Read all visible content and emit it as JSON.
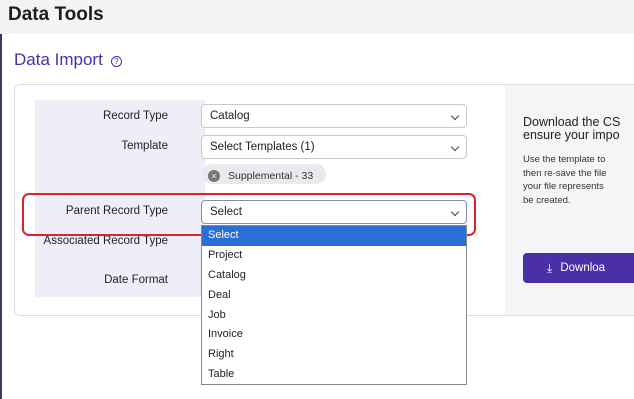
{
  "page": {
    "title": "Data Tools"
  },
  "section": {
    "title": "Data Import",
    "help_icon": "help-circle-icon"
  },
  "form": {
    "record_type": {
      "label": "Record Type",
      "value": "Catalog"
    },
    "template": {
      "label": "Template",
      "value": "Select Templates (1)",
      "chip": "Supplemental - 33"
    },
    "parent_record_type": {
      "label": "Parent Record Type",
      "value": "Select"
    },
    "associated_record_type": {
      "label": "Associated Record Type"
    },
    "date_format": {
      "label": "Date Format"
    }
  },
  "dropdown": {
    "options": [
      "Select",
      "Project",
      "Catalog",
      "Deal",
      "Job",
      "Invoice",
      "Right",
      "Table"
    ],
    "selected_index": 0
  },
  "download_panel": {
    "title_line1": "Download the CS",
    "title_line2": "ensure your impo",
    "desc_line1": "Use the template to",
    "desc_line2": "then re-save the file",
    "desc_line3": "your file represents",
    "desc_line4": "be created.",
    "button_label": "Downloa",
    "button_icon": "download-icon"
  },
  "colors": {
    "accent": "#4a2fa6",
    "highlight": "#e0202a",
    "selected_option": "#2a6fd8"
  }
}
